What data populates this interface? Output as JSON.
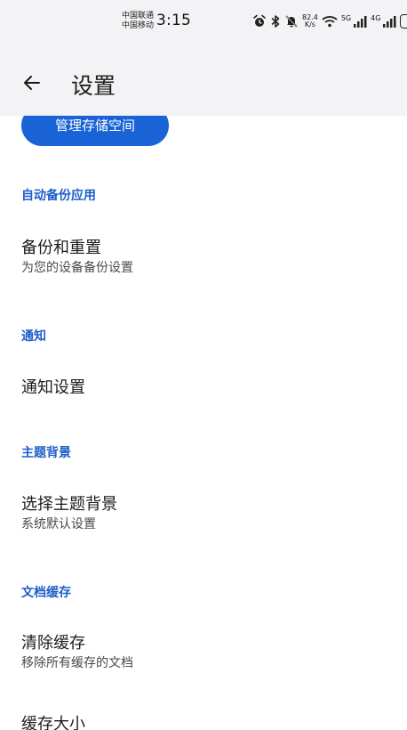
{
  "status_bar": {
    "carrier_1": "中国联通",
    "carrier_2": "中国移动",
    "time": "3:15",
    "net_speed_value": "82.4",
    "net_speed_unit": "K/s",
    "net_5g": "5G",
    "net_4g": "4G",
    "battery": "93",
    "icons": [
      "alarm-icon",
      "bluetooth-icon",
      "mute-icon",
      "wifi-icon",
      "signal-icon",
      "signal-icon",
      "battery-icon"
    ]
  },
  "app_bar": {
    "title": "设置",
    "back_icon": "arrow-left-icon"
  },
  "storage": {
    "manage_button": "管理存储空间"
  },
  "sections": {
    "backup": {
      "header": "自动备份应用",
      "item_title": "备份和重置",
      "item_subtitle": "为您的设备备份设置"
    },
    "notify": {
      "header": "通知",
      "item_title": "通知设置"
    },
    "theme": {
      "header": "主题背景",
      "item_title": "选择主题背景",
      "item_subtitle": "系统默认设置"
    },
    "cache": {
      "header": "文档缓存",
      "clear_title": "清除缓存",
      "clear_subtitle": "移除所有缓存的文档",
      "size_title": "缓存大小"
    }
  },
  "colors": {
    "accent": "#1e5fc9",
    "button_bg": "#1a63d6",
    "app_bar_bg": "#f3f3f6"
  }
}
